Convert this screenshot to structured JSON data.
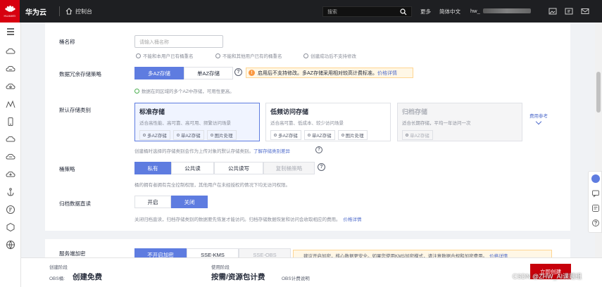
{
  "topbar": {
    "brand": "华为云",
    "logo_text": "HUAWEI",
    "console": "控制台",
    "search_placeholder": "搜索",
    "more": "更多",
    "language": "简体中文",
    "user": "hw_"
  },
  "form": {
    "bucket_name_label": "桶名称",
    "bucket_name_placeholder": "请输入桶名称",
    "name_hints": [
      "不能和本用户已有桶重名",
      "不能和其他用户已有的桶重名",
      "创建成功后不支持修改"
    ],
    "redundancy_label": "数据冗余存储策略",
    "redundancy_options": [
      "多AZ存储",
      "单AZ存储"
    ],
    "redundancy_notice": "启用后不支持修改。多AZ存储采用相对较高计费标准。",
    "redundancy_notice_link": "价格详情",
    "redundancy_hint": "数据在同区域的多个AZ中存储，可用性更高。",
    "storage_class_label": "默认存储类别",
    "storage_classes": [
      {
        "title": "标准存储",
        "desc": "适合高性能、高可靠、高可用、频繁访问场景",
        "tags": [
          "多AZ存储",
          "单AZ存储",
          "图片处理"
        ]
      },
      {
        "title": "低频访问存储",
        "desc": "适合高可靠、低成本、较少访问场景",
        "tags": [
          "多AZ存储",
          "单AZ存储",
          "图片处理"
        ]
      },
      {
        "title": "归档存储",
        "desc": "适合长期存储，平均一年访问一次",
        "tags": [
          "单AZ存储"
        ]
      }
    ],
    "fee_ref": "费用参考",
    "storage_class_hint": "创建桶时选择的存储类别会作为上传对象的默认存储类别。",
    "storage_class_link": "了解存储类别差异",
    "policy_label": "桶策略",
    "policy_options": [
      "私有",
      "公共读",
      "公共读写",
      "复制桶策略"
    ],
    "policy_hint": "桶的拥有者拥有完全控制权限，其他用户在未经授权的情况下均无访问权限。",
    "archive_label": "归档数据直读",
    "archive_options": [
      "开启",
      "关闭"
    ],
    "archive_hint": "关闭归档直读，归档存储类别的数据要先恢复才能访问。归档存储数据恢复和访问会收取相应的费用。",
    "archive_link": "价格详情",
    "encryption_label": "服务端加密",
    "encryption_options": [
      "不开启加密",
      "SSE-KMS",
      "SSE-OBS"
    ],
    "encryption_notice": "建议开启加密，核心数据更安全。如果您使用KMS加密模式，请注意数据合规和加密费用。",
    "encryption_link": "价格详情"
  },
  "bottom": {
    "stage1_label": "创建阶段",
    "stage1_prefix": "OBS桶:",
    "stage1_value": "创建免费",
    "stage2_label": "使用阶段",
    "stage2_value": "按需/资源包计费",
    "stage2_link": "OBS计费说明",
    "create_button": "立即创建"
  },
  "watermark": "CSDN @ZHW_AI课题组",
  "colors": {
    "primary": "#5e7ce0",
    "brand_red": "#c7000b",
    "warning": "#fa9841"
  }
}
